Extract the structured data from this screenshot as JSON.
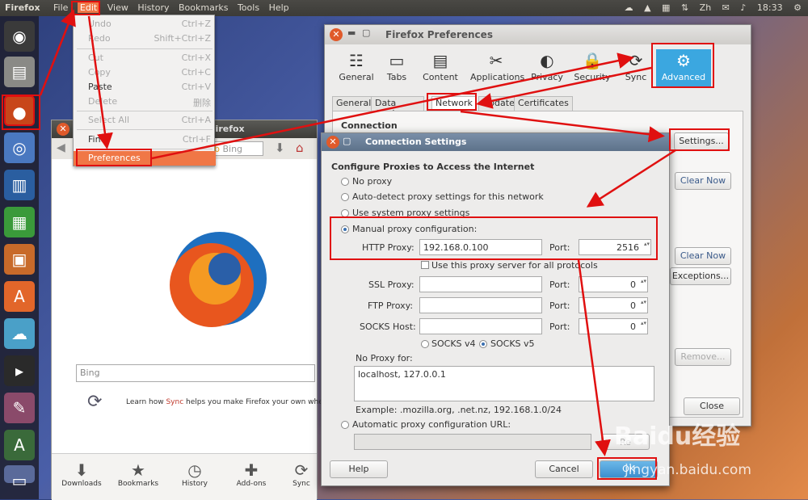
{
  "top_panel": {
    "app_name": "Firefox",
    "menu": [
      "File",
      "Edit",
      "View",
      "History",
      "Bookmarks",
      "Tools",
      "Help"
    ],
    "lang": "Zh",
    "clock": "18:33"
  },
  "edit_menu": {
    "items": [
      {
        "label": "Undo",
        "accel": "Ctrl+Z"
      },
      {
        "label": "Redo",
        "accel": "Shift+Ctrl+Z"
      },
      {
        "label": "Cut",
        "accel": "Ctrl+X"
      },
      {
        "label": "Copy",
        "accel": "Ctrl+C"
      },
      {
        "label": "Paste",
        "accel": "Ctrl+V"
      },
      {
        "label": "Delete",
        "accel": "删除"
      },
      {
        "label": "Select All",
        "accel": "Ctrl+A"
      },
      {
        "label": "Find",
        "accel": "Ctrl+F"
      },
      {
        "label": "Preferences",
        "accel": ""
      }
    ]
  },
  "firefox_window": {
    "title": "ge - Mozilla Firefox",
    "search_engine": "Bing",
    "search_placeholder": "Bing",
    "sync_text_pre": "Learn how ",
    "sync_link": "Sync",
    "sync_text_post": " helps you make Firefox your own wher",
    "bottom_items": [
      "Downloads",
      "Bookmarks",
      "History",
      "Add-ons",
      "Sync"
    ]
  },
  "preferences": {
    "title": "Firefox Preferences",
    "toolbar": [
      "General",
      "Tabs",
      "Content",
      "Applications",
      "Privacy",
      "Security",
      "Sync",
      "Advanced"
    ],
    "subtabs": [
      "General",
      "Data Choices",
      "Network",
      "Update",
      "Certificates"
    ],
    "connection_heading": "Connection",
    "settings_button": "Settings...",
    "clear_now_1": "Clear Now",
    "clear_now_2": "Clear Now",
    "exceptions_button": "Exceptions...",
    "remove_button": "Remove...",
    "close_button": "Close"
  },
  "connection_settings": {
    "title": "Connection Settings",
    "heading": "Configure Proxies to Access the Internet",
    "options": {
      "no_proxy": "No proxy",
      "auto_detect": "Auto-detect proxy settings for this network",
      "system": "Use system proxy settings",
      "manual": "Manual proxy configuration:",
      "auto_url": "Automatic proxy configuration URL:"
    },
    "http_proxy_label": "HTTP Proxy:",
    "http_proxy_value": "192.168.0.100",
    "http_port": "2516",
    "same_proxy_label": "Use this proxy server for all protocols",
    "ssl_label": "SSL Proxy:",
    "ssl_port": "0",
    "ftp_label": "FTP Proxy:",
    "ftp_port": "0",
    "socks_label": "SOCKS Host:",
    "socks_port": "0",
    "port_label": "Port:",
    "socks_v4": "SOCKS v4",
    "socks_v5": "SOCKS v5",
    "no_proxy_for_label": "No Proxy for:",
    "no_proxy_for_value": "localhost, 127.0.0.1",
    "example": "Example: .mozilla.org, .net.nz, 192.168.1.0/24",
    "reload_button": "Re",
    "help_button": "Help",
    "cancel_button": "Cancel",
    "ok_button": "OK"
  },
  "watermark": {
    "text": "Baidu经验",
    "url": "jingyan.baidu.com"
  },
  "colors": {
    "accent": "#f07746",
    "annotation": "#e01010",
    "advanced_tab": "#3ba7e0"
  }
}
